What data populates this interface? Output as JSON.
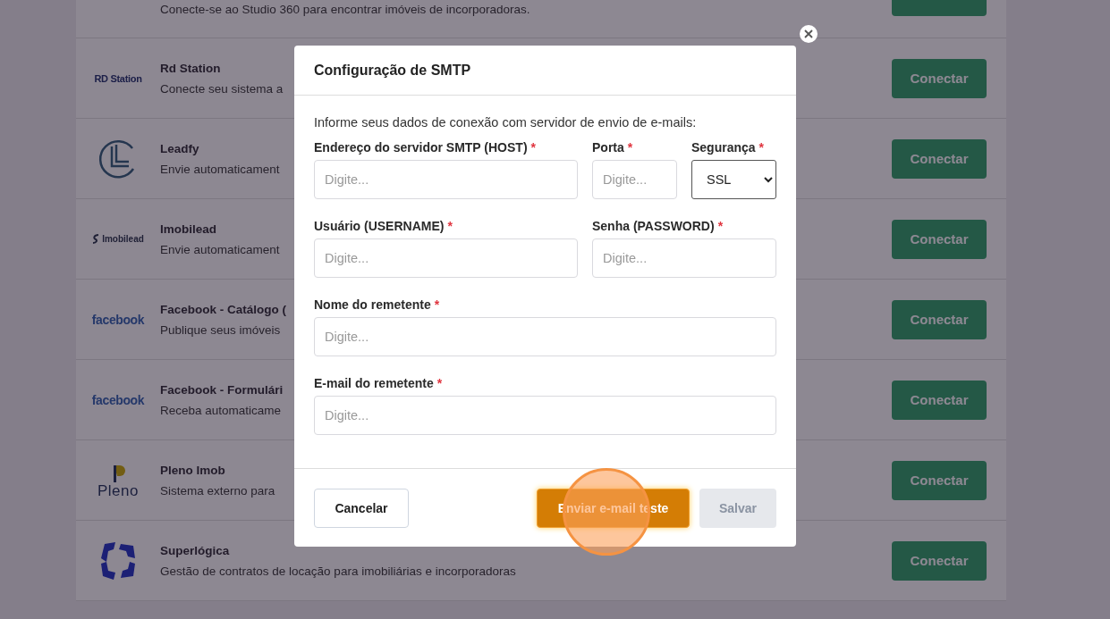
{
  "integrations": [
    {
      "logo": {
        "kind": "none"
      },
      "description": "Conecte-se ao Studio 360 para encontrar imóveis de incorporadoras."
    },
    {
      "logo": {
        "kind": "wordmark",
        "text": "RD Station"
      },
      "title": "Rd Station",
      "description": "Conecte seu sistema a",
      "button": "Conectar"
    },
    {
      "logo": {
        "kind": "ring"
      },
      "title": "Leadfy",
      "description": "Envie automaticament",
      "button": "Conectar"
    },
    {
      "logo": {
        "kind": "swirl",
        "text": "Imobilead"
      },
      "title": "Imobilead",
      "description": "Envie automaticament",
      "button": "Conectar"
    },
    {
      "logo": {
        "kind": "fb",
        "text": "facebook"
      },
      "title": "Facebook - Catálogo (",
      "description": "Publique seus imóveis",
      "button": "Conectar"
    },
    {
      "logo": {
        "kind": "fb",
        "text": "facebook"
      },
      "title": "Facebook - Formulári",
      "description": "Receba automaticame",
      "button": "Conectar"
    },
    {
      "logo": {
        "kind": "flag",
        "text": "Pleno"
      },
      "title": "Pleno Imob",
      "description": "Sistema externo para",
      "button": "Conectar"
    },
    {
      "logo": {
        "kind": "quad"
      },
      "title": "Superlógica",
      "description": "Gestão de contratos de locação para imobiliárias e incorporadoras",
      "button": "Conectar"
    }
  ],
  "modal": {
    "title": "Configuração de SMTP",
    "intro": "Informe seus dados de conexão com servidor de envio de e-mails:",
    "fields": [
      {
        "label": "Endereço do servidor SMTP (HOST)",
        "required_mark": "*",
        "kind": "text",
        "placeholder": "Digite..."
      },
      {
        "label": "Porta",
        "required_mark": "*",
        "kind": "text",
        "placeholder": "Digite..."
      },
      {
        "label": "Segurança",
        "required_mark": "*",
        "kind": "select",
        "value": "SSL"
      },
      {
        "label": "Usuário (USERNAME)",
        "required_mark": "*",
        "kind": "text",
        "placeholder": "Digite..."
      },
      {
        "label": "Senha (PASSWORD)",
        "required_mark": "*",
        "kind": "text",
        "placeholder": "Digite..."
      },
      {
        "label": "Nome do remetente",
        "required_mark": "*",
        "kind": "text",
        "placeholder": "Digite..."
      },
      {
        "label": "E-mail do remetente",
        "required_mark": "*",
        "kind": "text",
        "placeholder": "Digite..."
      }
    ],
    "buttons": [
      {
        "label": "Cancelar",
        "kind": "secondary",
        "disabled": false,
        "highlighted": false
      },
      {
        "label": "Enviar e-mail teste",
        "kind": "primary",
        "disabled": false,
        "highlighted": true
      },
      {
        "label": "Salvar",
        "kind": "primary",
        "disabled": true,
        "highlighted": false
      }
    ]
  }
}
